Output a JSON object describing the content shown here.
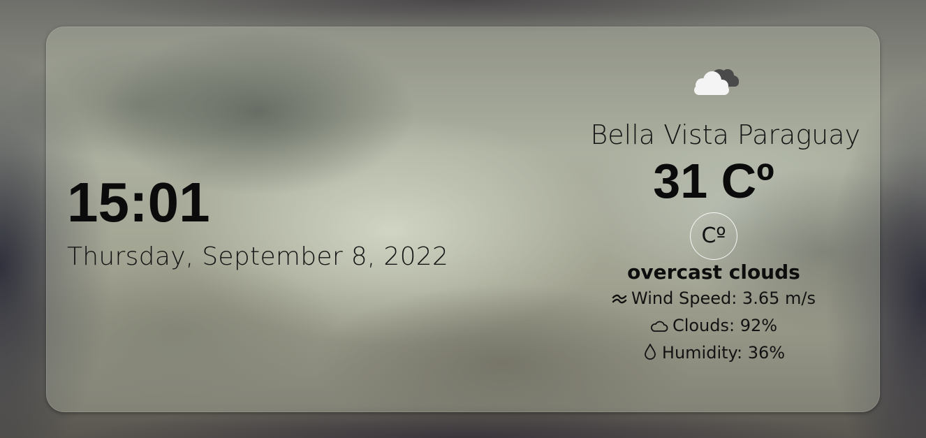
{
  "clock": {
    "time": "15:01",
    "date": "Thursday, September 8, 2022"
  },
  "weather": {
    "icon": "overcast-clouds-icon",
    "location": "Bella Vista Paraguay",
    "temperature": "31 Cº",
    "unit_toggle_label": "Cº",
    "description": "overcast clouds",
    "wind": {
      "icon": "wind-icon",
      "label": "Wind Speed: 3.65 m/s"
    },
    "clouds": {
      "icon": "cloud-icon",
      "label": "Clouds: 92%"
    },
    "humidity": {
      "icon": "droplet-icon",
      "label": "Humidity: 36%"
    }
  }
}
